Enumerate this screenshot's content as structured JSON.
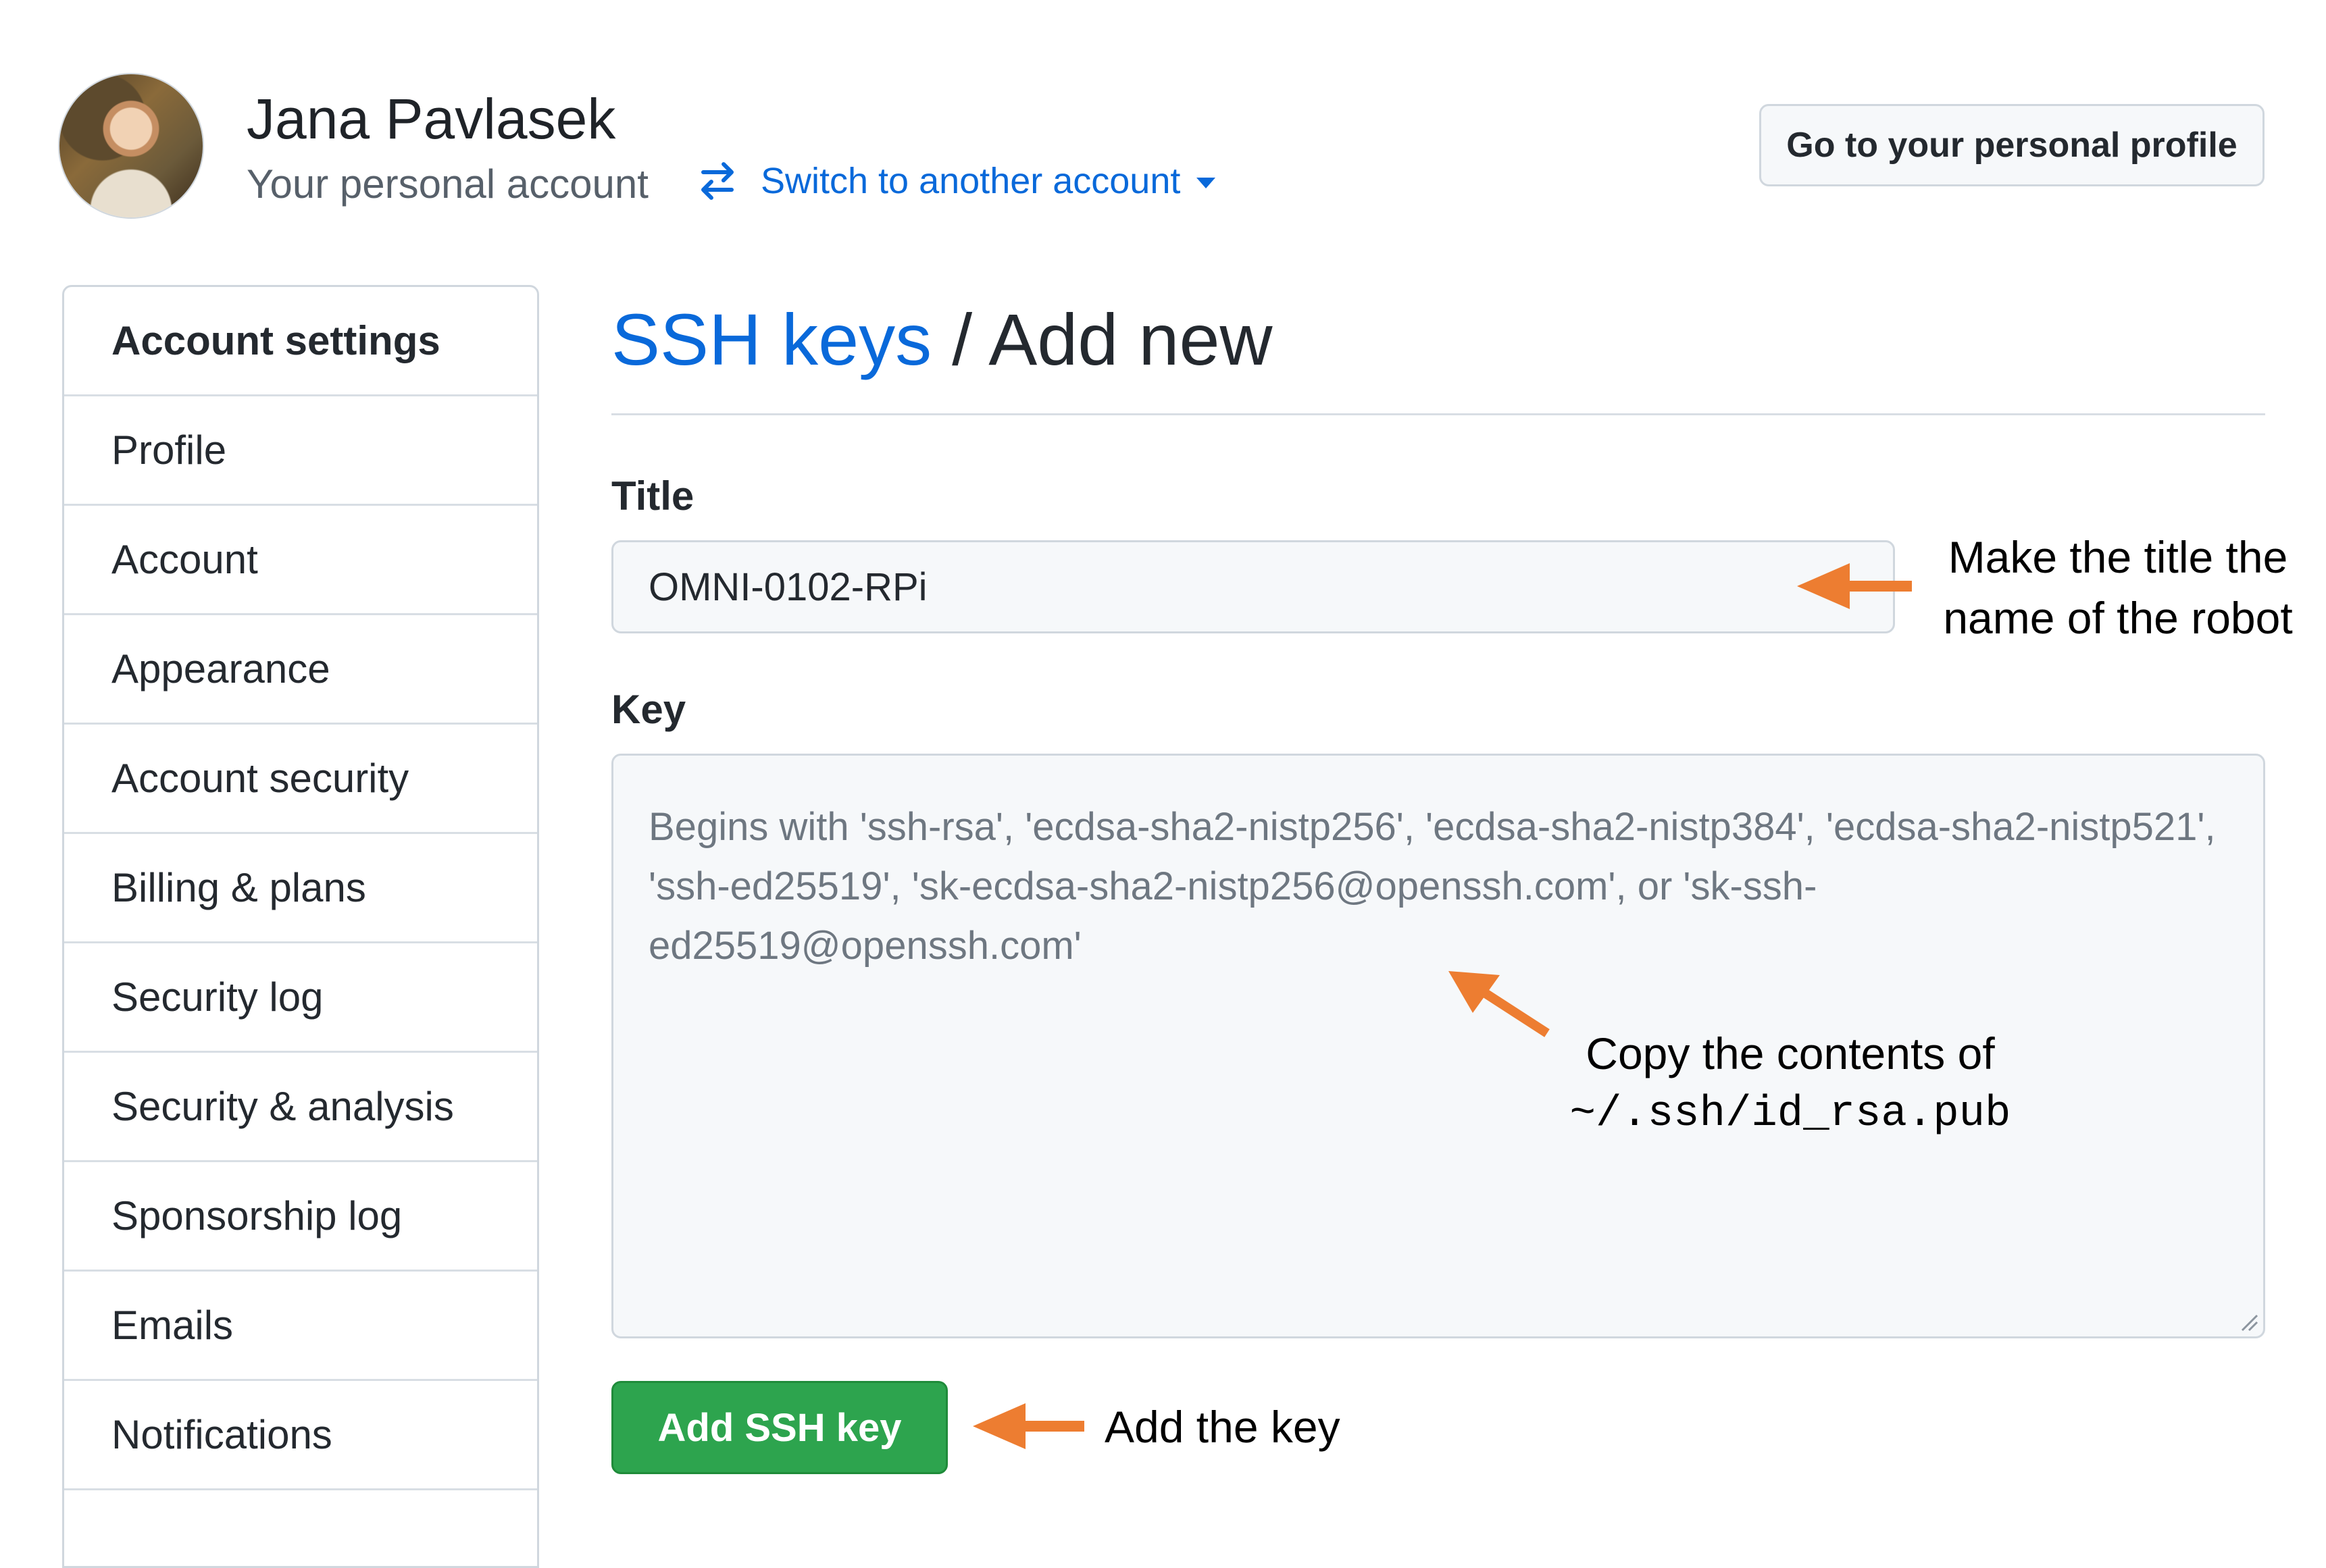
{
  "header": {
    "user_name": "Jana Pavlasek",
    "subtitle": "Your personal account",
    "switch_label": "Switch to another account",
    "profile_button": "Go to your personal profile"
  },
  "sidebar": {
    "heading": "Account settings",
    "items": [
      {
        "label": "Profile"
      },
      {
        "label": "Account"
      },
      {
        "label": "Appearance"
      },
      {
        "label": "Account security"
      },
      {
        "label": "Billing & plans"
      },
      {
        "label": "Security log"
      },
      {
        "label": "Security & analysis"
      },
      {
        "label": "Sponsorship log"
      },
      {
        "label": "Emails"
      },
      {
        "label": "Notifications"
      }
    ]
  },
  "main": {
    "title_link": "SSH keys",
    "title_separator": " / ",
    "title_rest": "Add new",
    "title_label": "Title",
    "title_value": "OMNI-0102-RPi",
    "key_label": "Key",
    "key_placeholder": "Begins with 'ssh-rsa', 'ecdsa-sha2-nistp256', 'ecdsa-sha2-nistp384', 'ecdsa-sha2-nistp521', 'ssh-ed25519', 'sk-ecdsa-sha2-nistp256@openssh.com', or 'sk-ssh-ed25519@openssh.com'",
    "key_value": "",
    "add_button": "Add SSH key"
  },
  "annotations": {
    "title_note_line1": "Make the title the",
    "title_note_line2": "name of the robot",
    "key_note_line1": "Copy the contents of",
    "key_note_line2": "~/.ssh/id_rsa.pub",
    "button_note": "Add the key"
  },
  "colors": {
    "link": "#0969da",
    "button_green": "#2da44e",
    "annotation_arrow": "#ed7d31",
    "border": "#d0d7de"
  },
  "icons": {
    "switch": "arrow-switch-icon",
    "caret": "caret-down-icon",
    "resize": "resize-grip-icon"
  }
}
